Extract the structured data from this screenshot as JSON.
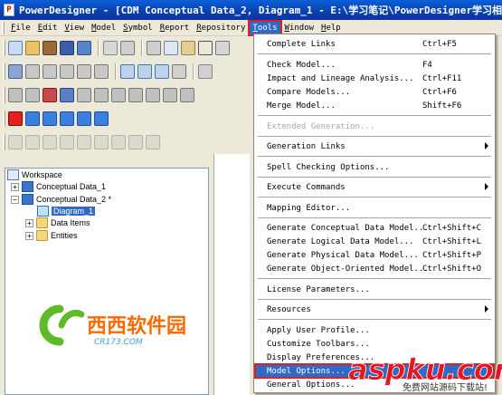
{
  "window": {
    "title": "PowerDesigner - [CDM Conceptual Data_2, Diagram_1 - E:\\学习笔记\\PowerDesigner学习相"
  },
  "menubar": {
    "items": [
      {
        "key": "F",
        "rest": "ile"
      },
      {
        "key": "E",
        "rest": "dit"
      },
      {
        "key": "V",
        "rest": "iew"
      },
      {
        "key": "M",
        "rest": "odel"
      },
      {
        "key": "S",
        "rest": "ymbol"
      },
      {
        "key": "R",
        "rest": "eport"
      },
      {
        "key": "R",
        "rest": "epository"
      },
      {
        "key": "T",
        "rest": "ools"
      },
      {
        "key": "W",
        "rest": "indow"
      },
      {
        "key": "H",
        "rest": "elp"
      }
    ]
  },
  "tree": {
    "items": [
      {
        "label": "Workspace"
      },
      {
        "label": "Conceptual Data_1"
      },
      {
        "label": "Conceptual Data_2 *"
      },
      {
        "label": "Diagram_1"
      },
      {
        "label": "Data Items"
      },
      {
        "label": "Entities"
      }
    ]
  },
  "tools_menu": {
    "items": [
      {
        "label": "Complete Links",
        "shortcut": "Ctrl+F5"
      },
      {
        "label": "Check Model...",
        "shortcut": "F4"
      },
      {
        "label": "Impact and Lineage Analysis...",
        "shortcut": "Ctrl+F11"
      },
      {
        "label": "Compare Models...",
        "shortcut": "Ctrl+F6"
      },
      {
        "label": "Merge Model...",
        "shortcut": "Shift+F6"
      },
      {
        "label": "Extended Generation...",
        "shortcut": ""
      },
      {
        "label": "Generation Links",
        "shortcut": ""
      },
      {
        "label": "Spell Checking Options...",
        "shortcut": ""
      },
      {
        "label": "Execute Commands",
        "shortcut": ""
      },
      {
        "label": "Mapping Editor...",
        "shortcut": ""
      },
      {
        "label": "Generate Conceptual Data Model...",
        "shortcut": "Ctrl+Shift+C"
      },
      {
        "label": "Generate Logical Data Model...",
        "shortcut": "Ctrl+Shift+L"
      },
      {
        "label": "Generate Physical Data Model...",
        "shortcut": "Ctrl+Shift+P"
      },
      {
        "label": "Generate Object-Oriented Model...",
        "shortcut": "Ctrl+Shift+O"
      },
      {
        "label": "License Parameters...",
        "shortcut": ""
      },
      {
        "label": "Resources",
        "shortcut": ""
      },
      {
        "label": "Apply User Profile...",
        "shortcut": ""
      },
      {
        "label": "Customize Toolbars...",
        "shortcut": ""
      },
      {
        "label": "Display Preferences...",
        "shortcut": ""
      },
      {
        "label": "Model Options...",
        "shortcut": ""
      },
      {
        "label": "General Options...",
        "shortcut": ""
      }
    ]
  },
  "watermarks": {
    "xixi_brand": "西西软件园",
    "xixi_url": "CR173.COM",
    "aspku_brand": "aspku.com",
    "aspku_tagline": "免费网站源码下载站!"
  },
  "colors": {
    "title_bar": "#0a3fb0",
    "menu_highlight": "#316ac5",
    "callout_box": "#e02020",
    "face": "#ece9d8"
  }
}
